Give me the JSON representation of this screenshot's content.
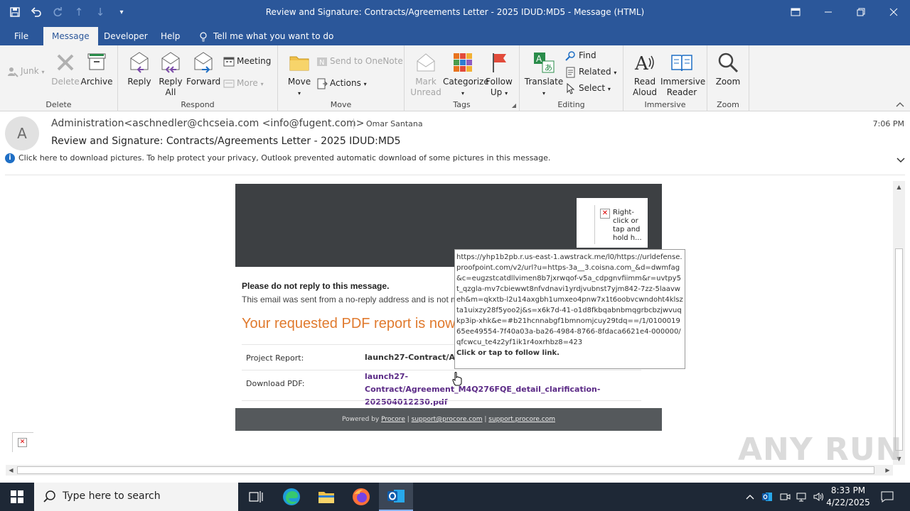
{
  "window": {
    "title": "Review and Signature: Contracts/Agreements Letter - 2025 IDUD:MD5  -  Message (HTML)"
  },
  "menu": {
    "tabs": [
      "File",
      "Message",
      "Developer",
      "Help"
    ],
    "tell_me": "Tell me what you want to do"
  },
  "ribbon": {
    "delete_group": {
      "junk": "Junk",
      "delete": "Delete",
      "archive": "Archive",
      "label": "Delete"
    },
    "respond_group": {
      "reply": "Reply",
      "reply_all_1": "Reply",
      "reply_all_2": "All",
      "forward": "Forward",
      "meeting": "Meeting",
      "more": "More",
      "label": "Respond"
    },
    "move_group": {
      "move": "Move",
      "onenote": "Send to OneNote",
      "actions": "Actions",
      "label": "Move"
    },
    "tags_group": {
      "mark_1": "Mark",
      "mark_2": "Unread",
      "categorize": "Categorize",
      "follow_1": "Follow",
      "follow_2": "Up",
      "label": "Tags"
    },
    "editing_group": {
      "translate": "Translate",
      "find": "Find",
      "related": "Related",
      "select": "Select",
      "label": "Editing"
    },
    "immersive_group": {
      "read_1": "Read",
      "read_2": "Aloud",
      "imm_1": "Immersive",
      "imm_2": "Reader",
      "label": "Immersive"
    },
    "zoom_group": {
      "zoom": "Zoom",
      "label": "Zoom"
    }
  },
  "header": {
    "avatar": "A",
    "sender": "Administration<aschnedler@chcseia.com <info@fugent.com>",
    "recipient": "Omar Santana",
    "time": "7:06 PM",
    "subject": "Review and Signature: Contracts/Agreements Letter - 2025 IDUD:MD5",
    "info": "Click here to download pictures. To help protect your privacy, Outlook prevented automatic download of some pictures in this message."
  },
  "email": {
    "broken_image_text": "Right-click or tap and hold h...",
    "noreply_title": "Please do not reply to this message.",
    "noreply_text": "This email was sent from a no-reply address and is not m",
    "headline": "Your requested PDF report is now",
    "project_label": "Project Report:",
    "project_value": "launch27-Contract/Agr",
    "download_label": "Download PDF:",
    "download_value": "launch27-Contract/Agreement_M4Q276FQE_detail_clarification-202504012230.pdf",
    "footer_prefix": "Powered by",
    "footer_link1": "Procore",
    "footer_link2": "support@procore.com",
    "footer_link3": "support.procore.com"
  },
  "tooltip": {
    "url": "https://yhp1b2pb.r.us-east-1.awstrack.me/l0/https://urldefense.proofpoint.com/v2/url?u=https-3a__3.coisna.com_&d=dwmfag&c=eugzstcatdllvimen8b7jxrwqof-v5a_cdpgnvfiimm&r=uvtpy5t_qzgla-mv7cbiewwt8nfvdnavi1yrdjvubnst7yjm842-7zz-5laavweh&m=qkxtb-l2u14axgbh1umxeo4pnw7x1t6oobvcwndoht4klszta1uixzy28f5yoo2j&s=x6k7d-41-o1d8fkbqabnbmqgrbcbzjwvuqkp3ip-xhk&e=#b21hcnnabgf1bmnomjcuy29tdq==/1/010001965ee49554-7f40a03a-ba26-4984-8766-8fdaca6621e4-000000/qfcwcu_te4z2yf1ik1r4oxrhbz8=423",
    "footer": "Click or tap to follow link."
  },
  "watermark": "ANY RUN",
  "taskbar": {
    "search_placeholder": "Type here to search",
    "time": "8:33 PM",
    "date": "4/22/2025"
  }
}
